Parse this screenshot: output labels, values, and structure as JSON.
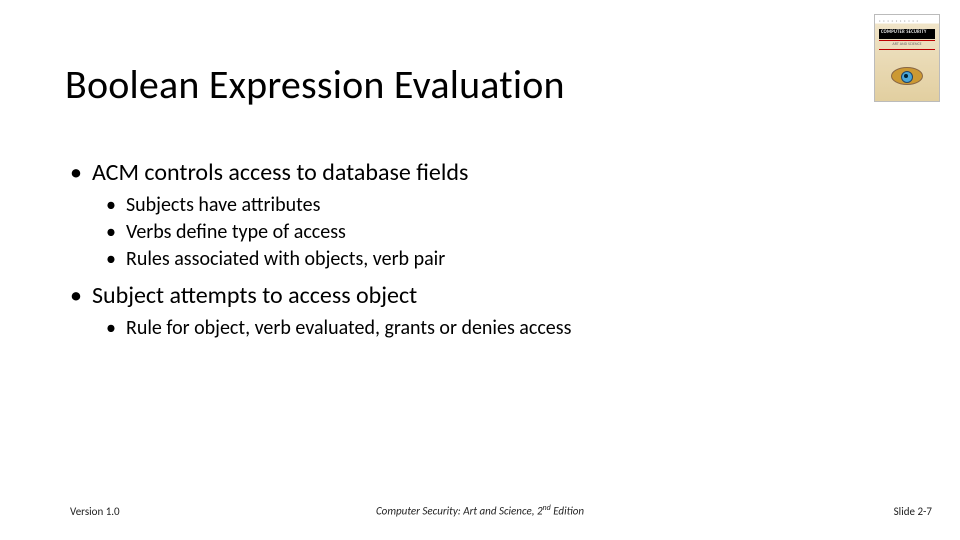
{
  "title": "Boolean Expression Evaluation",
  "bullets": {
    "b1": "ACM controls access to database fields",
    "b1a": "Subjects have attributes",
    "b1b": "Verbs define type of access",
    "b1c": "Rules associated with objects, verb pair",
    "b2": "Subject attempts to access object",
    "b2a": "Rule for object, verb evaluated, grants or denies access"
  },
  "footer": {
    "version": "Version 1.0",
    "book_title": "Computer Security: Art and Science",
    "edition_sep": ", ",
    "edition_num": "2",
    "edition_ord": "nd",
    "edition_word": " Edition",
    "slide": "Slide 2-7"
  },
  "cover": {
    "title_line": "COMPUTER SECURITY",
    "subtitle": "ART AND SCIENCE"
  }
}
